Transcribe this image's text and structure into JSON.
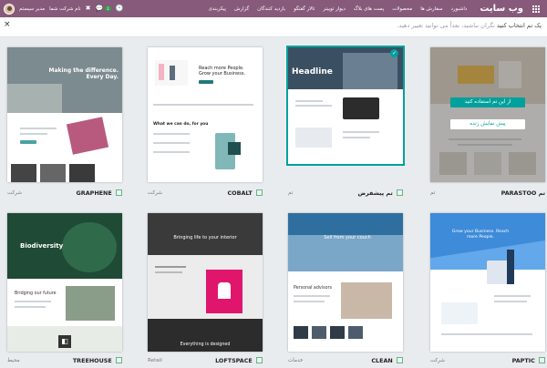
{
  "navbar": {
    "brand": "وب سایت",
    "menu": [
      "داشبورد",
      "سفارش ها",
      "محصولات",
      "پست های بلاگ",
      "دیوار توییتر",
      "تالار گفتگو",
      "بازدید کنندگان",
      "گزارش",
      "پیکربندی"
    ],
    "company": "نام شرکت شما",
    "user": "مدیر سیستم",
    "badge_count": "1",
    "bg_color": "#875a7b"
  },
  "subbar": {
    "title": "یک تم انتخاب کنید",
    "hint": "نگران نباشید، بعداً می توانید تغییر دهید."
  },
  "themes": [
    {
      "name": "PARASTOO",
      "category": "تم",
      "prefix": "تم"
    },
    {
      "name": "تم پیشفرض",
      "category": "تم"
    },
    {
      "name": "COBALT",
      "category": "شرکت"
    },
    {
      "name": "GRAPHENE",
      "category": "شرکت"
    },
    {
      "name": "PAPTIC",
      "category": "شرکت"
    },
    {
      "name": "CLEAN",
      "category": "خدمات"
    },
    {
      "name": "LOFTSPACE",
      "category": "Retail"
    },
    {
      "name": "TREEHOUSE",
      "category": "محیط"
    }
  ],
  "hover_actions": {
    "use_label": "از این تم استفاده کنید",
    "demo_label": "پیش نمایش زنده"
  },
  "thumbs": {
    "graphene_headline": "Making the difference. Every Day.",
    "cobalt_headline": "Reach more People. Grow your Business.",
    "cobalt_sub": "What we can do, for you",
    "default_headline": "Headline",
    "paptic_headline": "Grow your Business. Reach more People.",
    "clean_headline": "Sell from your couch",
    "clean_sub": "Personal advisors",
    "loft_headline": "Bringing life to your interior",
    "loft_sub": "Everything is designed",
    "tree_headline": "Biodiversity",
    "tree_sub": "Bridging our future"
  },
  "colors": {
    "accent": "#00a09d"
  }
}
